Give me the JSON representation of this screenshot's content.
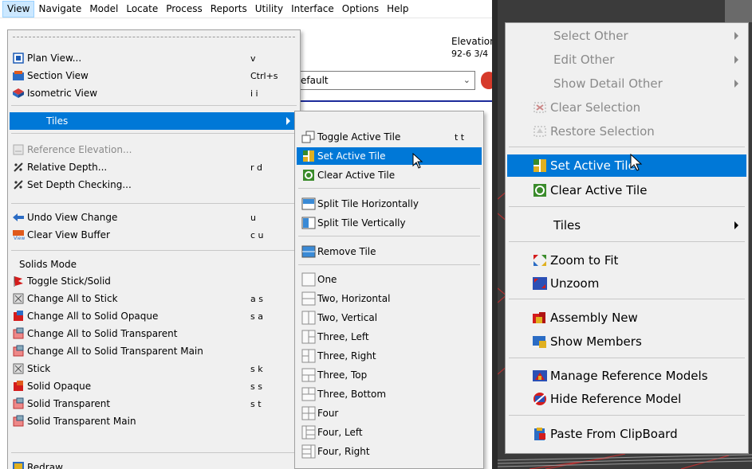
{
  "menubar": {
    "items": [
      "View",
      "Navigate",
      "Model",
      "Locate",
      "Process",
      "Reports",
      "Utility",
      "Interface",
      "Options",
      "Help"
    ]
  },
  "background": {
    "elevation_label": "Elevation",
    "elevation_value": "92-6 3/4",
    "combo_value": "efault"
  },
  "view_menu": {
    "items": [
      {
        "label": "Plan View...",
        "shortcut": "v",
        "icon": "plan-view-icon"
      },
      {
        "label": "Section View",
        "shortcut": "Ctrl+s",
        "icon": "section-view-icon"
      },
      {
        "label": "Isometric View",
        "shortcut": "i i",
        "icon": "isometric-view-icon"
      },
      {
        "label": "Tiles",
        "shortcut": "",
        "icon": ""
      },
      {
        "label": "Reference Elevation...",
        "shortcut": "",
        "icon": "reference-elevation-icon"
      },
      {
        "label": "Relative Depth...",
        "shortcut": "r d",
        "icon": "relative-depth-icon"
      },
      {
        "label": "Set Depth Checking...",
        "shortcut": "",
        "icon": "depth-checking-icon"
      },
      {
        "label": "Undo View Change",
        "shortcut": "u",
        "icon": "undo-view-icon"
      },
      {
        "label": "Clear View Buffer",
        "shortcut": "c u",
        "icon": "clear-view-buffer-icon"
      },
      {
        "label": "Toggle Stick/Solid",
        "shortcut": "",
        "icon": "toggle-stick-solid-icon"
      },
      {
        "label": "Change All to Stick",
        "shortcut": "a s",
        "icon": "change-all-stick-icon"
      },
      {
        "label": "Change All to Solid Opaque",
        "shortcut": "s a",
        "icon": "change-all-solid-opaque-icon"
      },
      {
        "label": "Change All to Solid Transparent",
        "shortcut": "",
        "icon": "change-all-solid-transparent-icon"
      },
      {
        "label": "Change All to Solid Transparent Main",
        "shortcut": "",
        "icon": "change-all-solid-transparent-main-icon"
      },
      {
        "label": "Stick",
        "shortcut": "s k",
        "icon": "stick-icon"
      },
      {
        "label": "Solid Opaque",
        "shortcut": "s s",
        "icon": "solid-opaque-icon"
      },
      {
        "label": "Solid Transparent",
        "shortcut": "s t",
        "icon": "solid-transparent-icon"
      },
      {
        "label": "Solid Transparent Main",
        "shortcut": "",
        "icon": "solid-transparent-main-icon"
      },
      {
        "label": "Redraw",
        "shortcut": "",
        "icon": "redraw-icon"
      }
    ],
    "solids_heading": "Solids Mode"
  },
  "tiles_menu": {
    "items": [
      {
        "label": "Toggle Active Tile",
        "shortcut": "t t"
      },
      {
        "label": "Set Active Tile",
        "shortcut": ""
      },
      {
        "label": "Clear Active Tile",
        "shortcut": ""
      },
      {
        "label": "Split Tile Horizontally",
        "shortcut": ""
      },
      {
        "label": "Split Tile Vertically",
        "shortcut": ""
      },
      {
        "label": "Remove Tile",
        "shortcut": ""
      },
      {
        "label": "One",
        "shortcut": ""
      },
      {
        "label": "Two, Horizontal",
        "shortcut": ""
      },
      {
        "label": "Two, Vertical",
        "shortcut": ""
      },
      {
        "label": "Three, Left",
        "shortcut": ""
      },
      {
        "label": "Three, Right",
        "shortcut": ""
      },
      {
        "label": "Three, Top",
        "shortcut": ""
      },
      {
        "label": "Three, Bottom",
        "shortcut": ""
      },
      {
        "label": "Four",
        "shortcut": ""
      },
      {
        "label": "Four, Left",
        "shortcut": ""
      },
      {
        "label": "Four, Right",
        "shortcut": ""
      }
    ]
  },
  "context_menu": {
    "items": [
      {
        "label": "Select Other"
      },
      {
        "label": "Edit Other"
      },
      {
        "label": "Show Detail Other"
      },
      {
        "label": "Clear Selection"
      },
      {
        "label": "Restore Selection"
      },
      {
        "label": "Set Active Tile"
      },
      {
        "label": "Clear Active Tile"
      },
      {
        "label": "Tiles"
      },
      {
        "label": "Zoom to Fit"
      },
      {
        "label": "Unzoom"
      },
      {
        "label": "Assembly New"
      },
      {
        "label": "Show Members"
      },
      {
        "label": "Manage Reference Models"
      },
      {
        "label": "Hide Reference Model"
      },
      {
        "label": "Paste From ClipBoard"
      }
    ]
  },
  "colors": {
    "highlight": "#0078d7",
    "menu_bg": "#f0f0f0",
    "cad_bg": "#3b3b3b",
    "cad_lines": "#b03030"
  }
}
